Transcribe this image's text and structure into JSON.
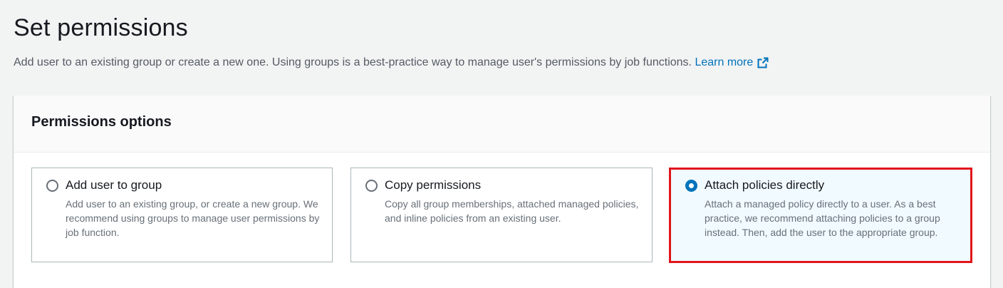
{
  "page": {
    "title": "Set permissions",
    "description": "Add user to an existing group or create a new one. Using groups is a best-practice way to manage user's permissions by job functions.",
    "learn_more": "Learn more"
  },
  "panel": {
    "header": "Permissions options",
    "options": [
      {
        "label": "Add user to group",
        "description": "Add user to an existing group, or create a new group. We recommend using groups to manage user permissions by job function.",
        "selected": false
      },
      {
        "label": "Copy permissions",
        "description": "Copy all group memberships, attached managed policies, and inline policies from an existing user.",
        "selected": false
      },
      {
        "label": "Attach policies directly",
        "description": "Attach a managed policy directly to a user. As a best practice, we recommend attaching policies to a group instead. Then, add the user to the appropriate group.",
        "selected": true
      }
    ]
  },
  "colors": {
    "link": "#0073bb",
    "selected_border": "#0073bb",
    "selected_background": "#f1faff",
    "annotation_outline": "#e0151b"
  },
  "icons": {
    "learn_more": "external-link-icon"
  }
}
